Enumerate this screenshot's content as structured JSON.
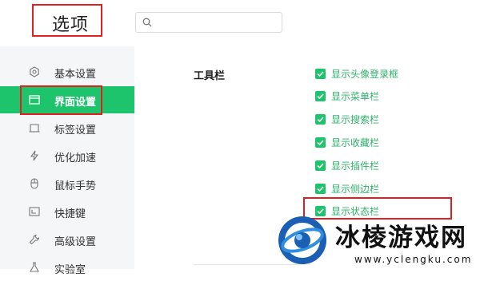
{
  "header": {
    "title": "选项",
    "search": {
      "value": "",
      "placeholder": ""
    }
  },
  "sidebar": {
    "items": [
      {
        "label": "基本设置",
        "icon": "gear-icon",
        "active": false
      },
      {
        "label": "界面设置",
        "icon": "window-icon",
        "active": true
      },
      {
        "label": "标签设置",
        "icon": "tab-icon",
        "active": false
      },
      {
        "label": "优化加速",
        "icon": "lightning-icon",
        "active": false
      },
      {
        "label": "鼠标手势",
        "icon": "mouse-icon",
        "active": false
      },
      {
        "label": "快捷键",
        "icon": "keyboard-icon",
        "active": false
      },
      {
        "label": "高级设置",
        "icon": "wrench-icon",
        "active": false
      },
      {
        "label": "实验室",
        "icon": "flask-icon",
        "active": false
      }
    ]
  },
  "main": {
    "section_label": "工具栏",
    "options": [
      {
        "label": "显示头像登录框",
        "checked": true
      },
      {
        "label": "显示菜单栏",
        "checked": true
      },
      {
        "label": "显示搜索栏",
        "checked": true
      },
      {
        "label": "显示收藏栏",
        "checked": true
      },
      {
        "label": "显示插件栏",
        "checked": true
      },
      {
        "label": "显示侧边栏",
        "checked": true
      },
      {
        "label": "显示状态栏",
        "checked": true
      }
    ]
  },
  "watermark": {
    "name": "冰棱游戏网",
    "url": "www.yclengku.com"
  },
  "colors": {
    "accent": "#1ec46b",
    "highlight_box": "#e02020",
    "option_text": "#2fb26a",
    "sidebar_bg": "#f5f6f7"
  }
}
